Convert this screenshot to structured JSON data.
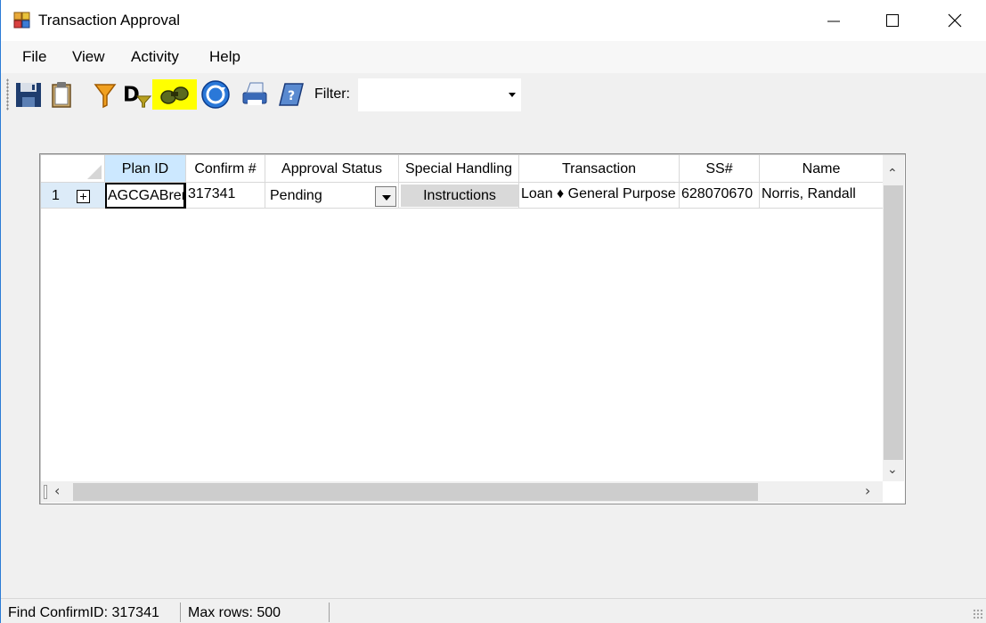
{
  "window": {
    "title": "Transaction Approval"
  },
  "menu": [
    "File",
    "View",
    "Activity",
    "Help"
  ],
  "toolbar": {
    "icons": [
      "save-icon",
      "clipboard-icon",
      "filter-funnel-icon",
      "d-filter-icon",
      "binoculars-icon",
      "refresh-icon",
      "print-icon",
      "help-book-icon"
    ],
    "filter_label": "Filter:",
    "filter_value": ""
  },
  "grid": {
    "columns": [
      "Plan ID",
      "Confirm #",
      "Approval Status",
      "Special Handling",
      "Transaction",
      "SS#",
      "Name"
    ],
    "rows": [
      {
        "row_number": "1",
        "plan_id": "AGCGABren",
        "confirm": "317341",
        "approval_status": "Pending",
        "special_handling": "Instructions",
        "transaction": "Loan ♦ General Purpose",
        "ssn": "628070670",
        "name": "Norris, Randall"
      }
    ]
  },
  "status": {
    "find": "Find ConfirmID: 317341",
    "max_rows": "Max rows: 500"
  },
  "colors": {
    "accent": "#2b7bd6",
    "selected_header": "#cce8ff",
    "row_header": "#dcebf8"
  }
}
